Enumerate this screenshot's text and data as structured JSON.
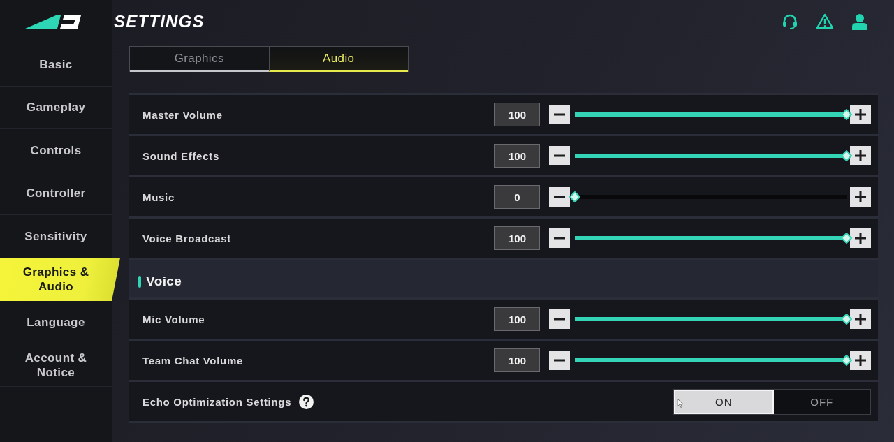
{
  "header": {
    "title": "SETTINGS"
  },
  "sidebar": {
    "items": [
      {
        "label": "Basic",
        "selected": false
      },
      {
        "label": "Gameplay",
        "selected": false
      },
      {
        "label": "Controls",
        "selected": false
      },
      {
        "label": "Controller",
        "selected": false
      },
      {
        "label": "Sensitivity",
        "selected": false
      },
      {
        "label": "Graphics & Audio",
        "selected": true
      },
      {
        "label": "Language",
        "selected": false
      },
      {
        "label": "Account & Notice",
        "selected": false
      }
    ]
  },
  "tabs": [
    {
      "label": "Graphics",
      "selected": false
    },
    {
      "label": "Audio",
      "selected": true
    }
  ],
  "sections": [
    {
      "rows": [
        {
          "kind": "slider",
          "label": "Master Volume",
          "value": "100",
          "level": 1
        },
        {
          "kind": "slider",
          "label": "Sound Effects",
          "value": "100",
          "level": 1
        },
        {
          "kind": "slider",
          "label": "Music",
          "value": "0",
          "level": 0
        },
        {
          "kind": "slider",
          "label": "Voice Broadcast",
          "value": "100",
          "level": 1
        }
      ]
    },
    {
      "title": "Voice",
      "rows": [
        {
          "kind": "slider",
          "label": "Mic Volume",
          "value": "100",
          "level": 1
        },
        {
          "kind": "slider",
          "label": "Team Chat Volume",
          "value": "100",
          "level": 1
        },
        {
          "kind": "toggle",
          "label": "Echo Optimization Settings",
          "help": true,
          "options": [
            {
              "label": "ON",
              "selected": true
            },
            {
              "label": "OFF",
              "selected": false
            }
          ]
        }
      ]
    }
  ]
}
